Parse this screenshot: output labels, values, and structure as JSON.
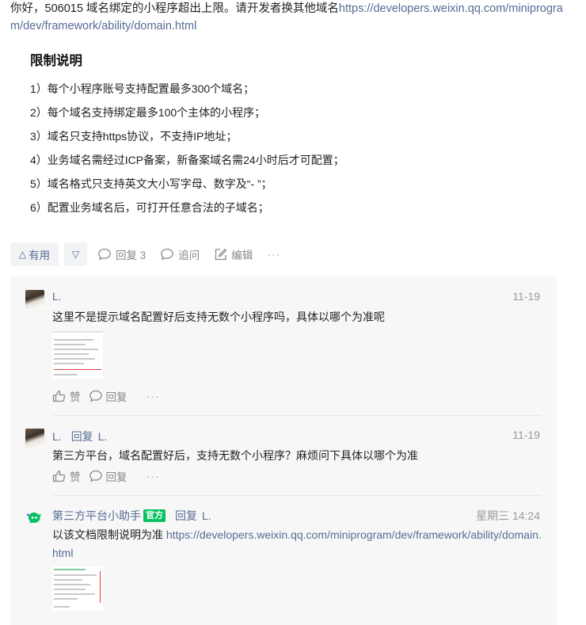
{
  "answer": {
    "intro_text": "你好，506015 域名绑定的小程序超出上限。请开发者换其他域名",
    "intro_link": "https://developers.weixin.qq.com/miniprogram/dev/framework/ability/domain.html",
    "limit_title": "限制说明",
    "limits": [
      "1）每个小程序账号支持配置最多300个域名；",
      "2）每个域名支持绑定最多100个主体的小程序；",
      "3）域名只支持https协议，不支持IP地址；",
      "4）业务域名需经过ICP备案，新备案域名需24小时后才可配置；",
      "5）域名格式只支持英文大小写字母、数字及“- ”；",
      "6）配置业务域名后，可打开任意合法的子域名；"
    ]
  },
  "actions": {
    "useful_label": "有用",
    "reply_label": "回复 3",
    "follow_label": "追问",
    "edit_label": "编辑",
    "more_label": "···"
  },
  "comments": [
    {
      "author": "L.",
      "time": "11-19",
      "text": "这里不是提示域名配置好后支持无数个小程序吗，具体以哪个为准呢",
      "like_label": "赞",
      "reply_label": "回复",
      "more_label": "···"
    },
    {
      "author": "L.",
      "reply_word": "回复",
      "reply_to": "L.",
      "time": "11-19",
      "text": "第三方平台，域名配置好后，支持无数个小程序？麻烦问下具体以哪个为准",
      "like_label": "赞",
      "reply_label": "回复",
      "more_label": "···"
    },
    {
      "author": "第三方平台小助手",
      "badge": "官方",
      "reply_word": "回复",
      "reply_to": "L.",
      "time": "星期三 14:24",
      "text": "以该文档限制说明为准 ",
      "link": "https://developers.weixin.qq.com/miniprogram/dev/framework/ability/domain.html"
    }
  ],
  "colors": {
    "link": "#576b95",
    "official_badge": "#07c160",
    "comment_bg": "#f7f7f7"
  }
}
